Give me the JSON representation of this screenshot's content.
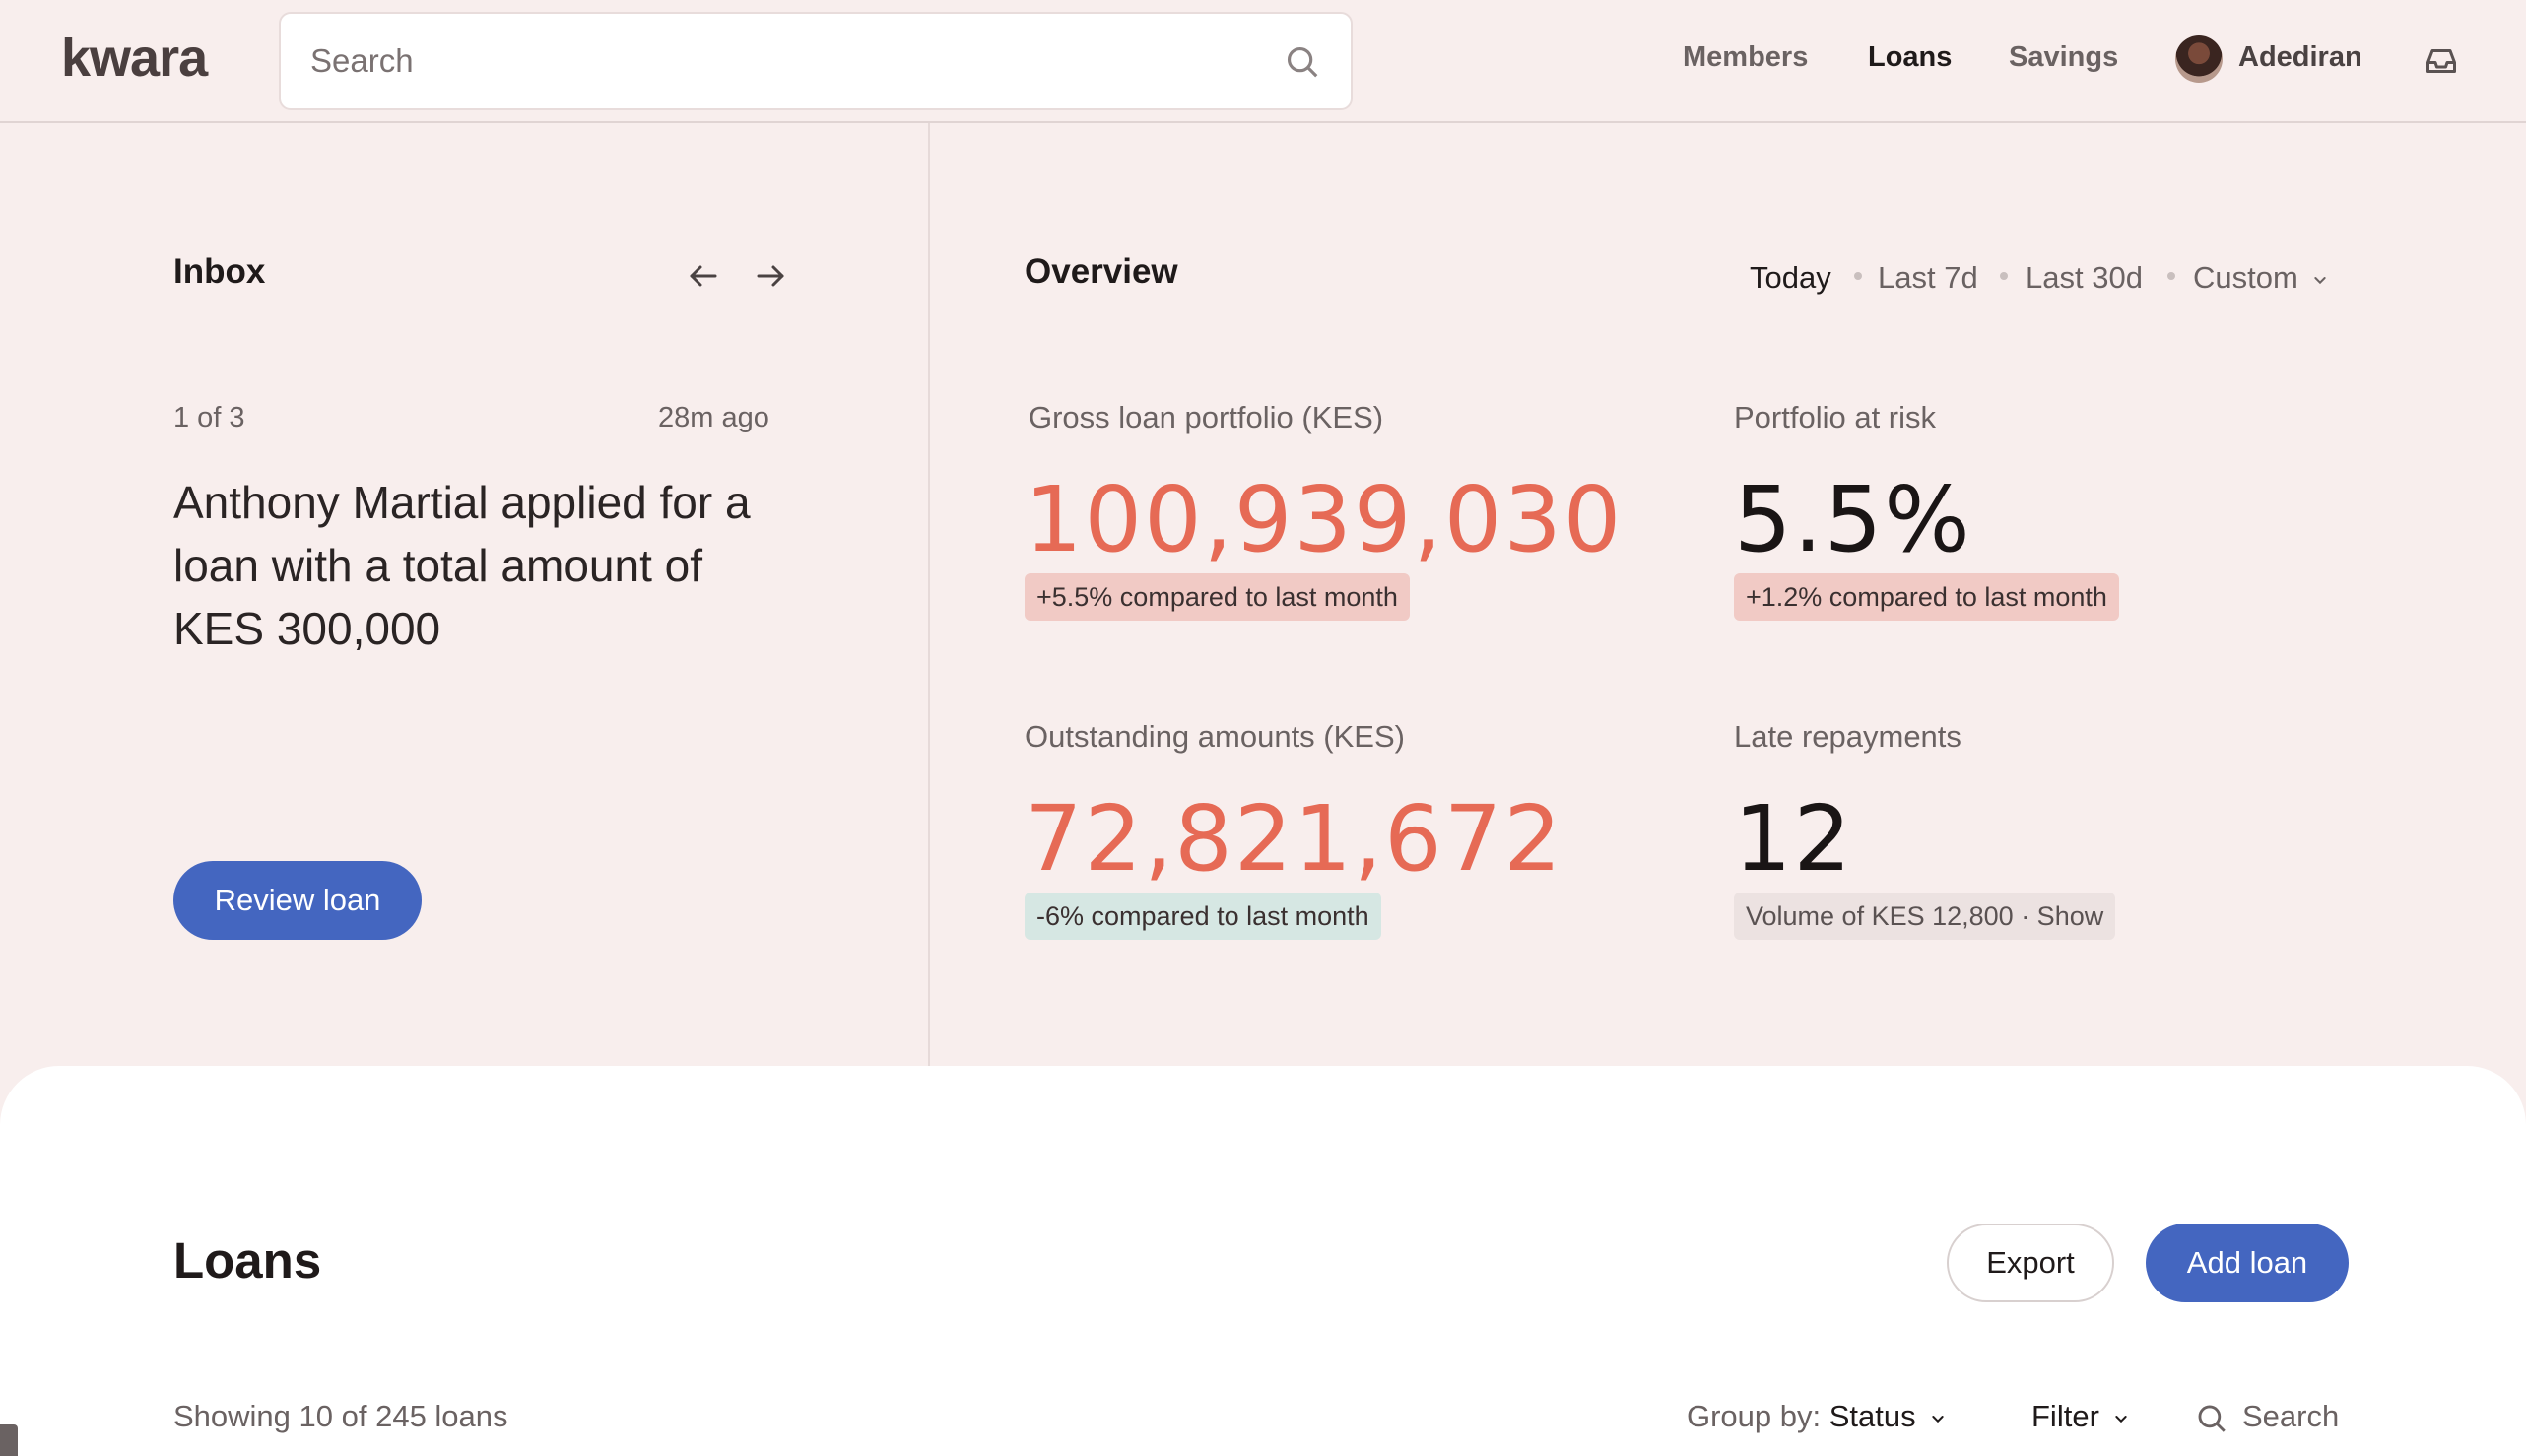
{
  "brand": {
    "logo": "kwara",
    "accent": "#4466c0",
    "highlight": "#e66a55"
  },
  "search": {
    "placeholder": "Search",
    "icon": "search-icon"
  },
  "nav": {
    "items": [
      {
        "label": "Members"
      },
      {
        "label": "Loans",
        "active": true
      },
      {
        "label": "Savings"
      }
    ],
    "user": {
      "name": "Adediran"
    },
    "inbox_icon": "inbox-icon"
  },
  "inbox": {
    "title": "Inbox",
    "position": "1 of 3",
    "time": "28m ago",
    "message": "Anthony Martial applied for a loan with a total amount of KES 300,000",
    "action": "Review loan"
  },
  "overview": {
    "title": "Overview",
    "ranges": [
      {
        "label": "Today",
        "active": true
      },
      {
        "label": "Last 7d"
      },
      {
        "label": "Last 30d"
      },
      {
        "label": "Custom"
      }
    ],
    "metrics": [
      {
        "label": "Gross loan portfolio (KES)",
        "value": "100,939,030",
        "note": "+5.5% compared to last month"
      },
      {
        "label": "Portfolio at risk",
        "value": "5.5%",
        "note": "+1.2% compared to last month"
      },
      {
        "label": "Outstanding amounts (KES)",
        "value": "72,821,672",
        "note": "-6% compared to last month"
      },
      {
        "label": "Late repayments",
        "value": "12",
        "note": "Volume of KES 12,800 · Show"
      }
    ]
  },
  "loans": {
    "title": "Loans",
    "export_label": "Export",
    "add_label": "Add loan",
    "showing": "Showing 10 of 245 loans",
    "group_by_label": "Group by:",
    "group_by_value": "Status",
    "filter_label": "Filter",
    "search_label": "Search"
  }
}
